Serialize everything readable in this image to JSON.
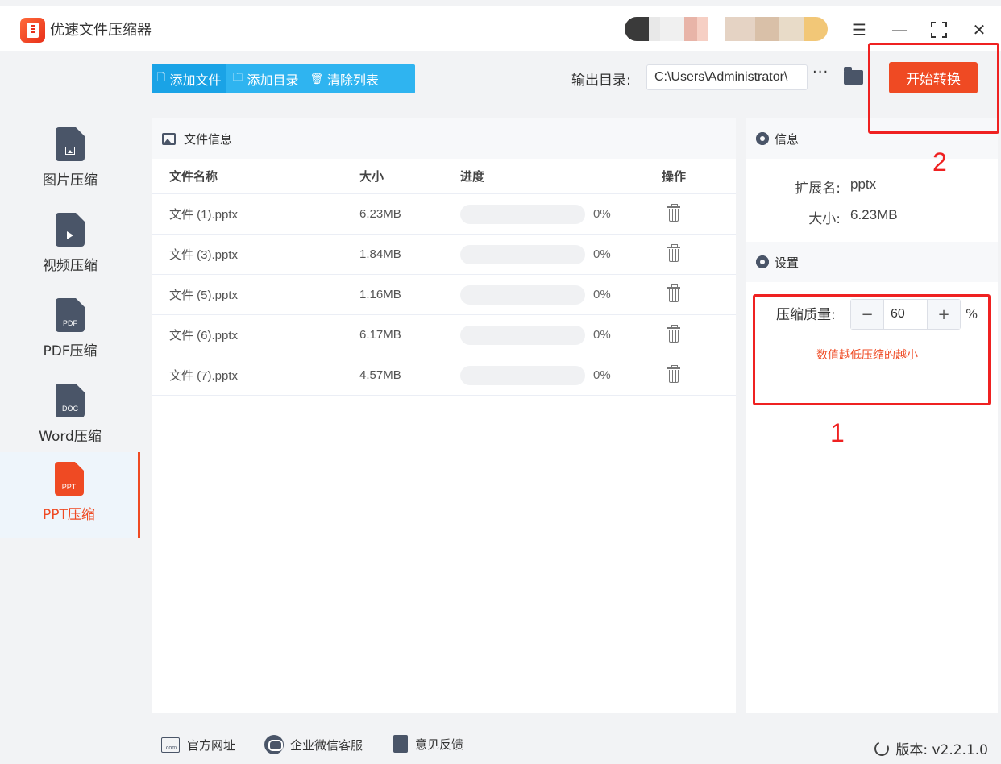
{
  "window": {
    "title": "优速文件压缩器",
    "controls": [
      "menu-icon",
      "minimize-icon",
      "maximize-icon",
      "close-icon"
    ]
  },
  "sidebar": {
    "items": [
      {
        "label": "图片压缩",
        "icon": "image-file-icon",
        "badge": ""
      },
      {
        "label": "视频压缩",
        "icon": "video-file-icon",
        "badge": ""
      },
      {
        "label": "PDF压缩",
        "icon": "pdf-file-icon",
        "badge": "PDF"
      },
      {
        "label": "Word压缩",
        "icon": "word-file-icon",
        "badge": "DOC"
      },
      {
        "label": "PPT压缩",
        "icon": "ppt-file-icon",
        "badge": "PPT"
      }
    ],
    "active_index": 4
  },
  "toolbar": {
    "add_file": "添加文件",
    "add_dir": "添加目录",
    "clear_list": "清除列表",
    "output_label": "输出目录:",
    "output_path": "C:\\Users\\Administrator\\",
    "more": "···",
    "start": "开始转换"
  },
  "file_panel": {
    "title": "文件信息",
    "columns": {
      "name": "文件名称",
      "size": "大小",
      "progress": "进度",
      "action": "操作"
    },
    "rows": [
      {
        "name": "文件 (1).pptx",
        "size": "6.23MB",
        "progress": 0,
        "progress_text": "0%"
      },
      {
        "name": "文件 (3).pptx",
        "size": "1.84MB",
        "progress": 0,
        "progress_text": "0%"
      },
      {
        "name": "文件 (5).pptx",
        "size": "1.16MB",
        "progress": 0,
        "progress_text": "0%"
      },
      {
        "name": "文件 (6).pptx",
        "size": "6.17MB",
        "progress": 0,
        "progress_text": "0%"
      },
      {
        "name": "文件 (7).pptx",
        "size": "4.57MB",
        "progress": 0,
        "progress_text": "0%"
      }
    ]
  },
  "info_panel": {
    "title": "信息",
    "ext_label": "扩展名:",
    "ext_value": "pptx",
    "size_label": "大小:",
    "size_value": "6.23MB"
  },
  "settings": {
    "title": "设置",
    "quality_label": "压缩质量:",
    "quality_value": "60",
    "minus": "−",
    "plus": "+",
    "unit": "%",
    "hint": "数值越低压缩的越小"
  },
  "annotations": {
    "box1_number": "1",
    "box2_number": "2"
  },
  "footer": {
    "website": "官方网址",
    "wechat": "企业微信客服",
    "feedback": "意见反馈",
    "version": "版本: v2.2.1.0"
  },
  "colors": {
    "accent": "#ef4a23",
    "primary_blue": "#2fb4f0",
    "annotation_red": "#ef2121"
  }
}
